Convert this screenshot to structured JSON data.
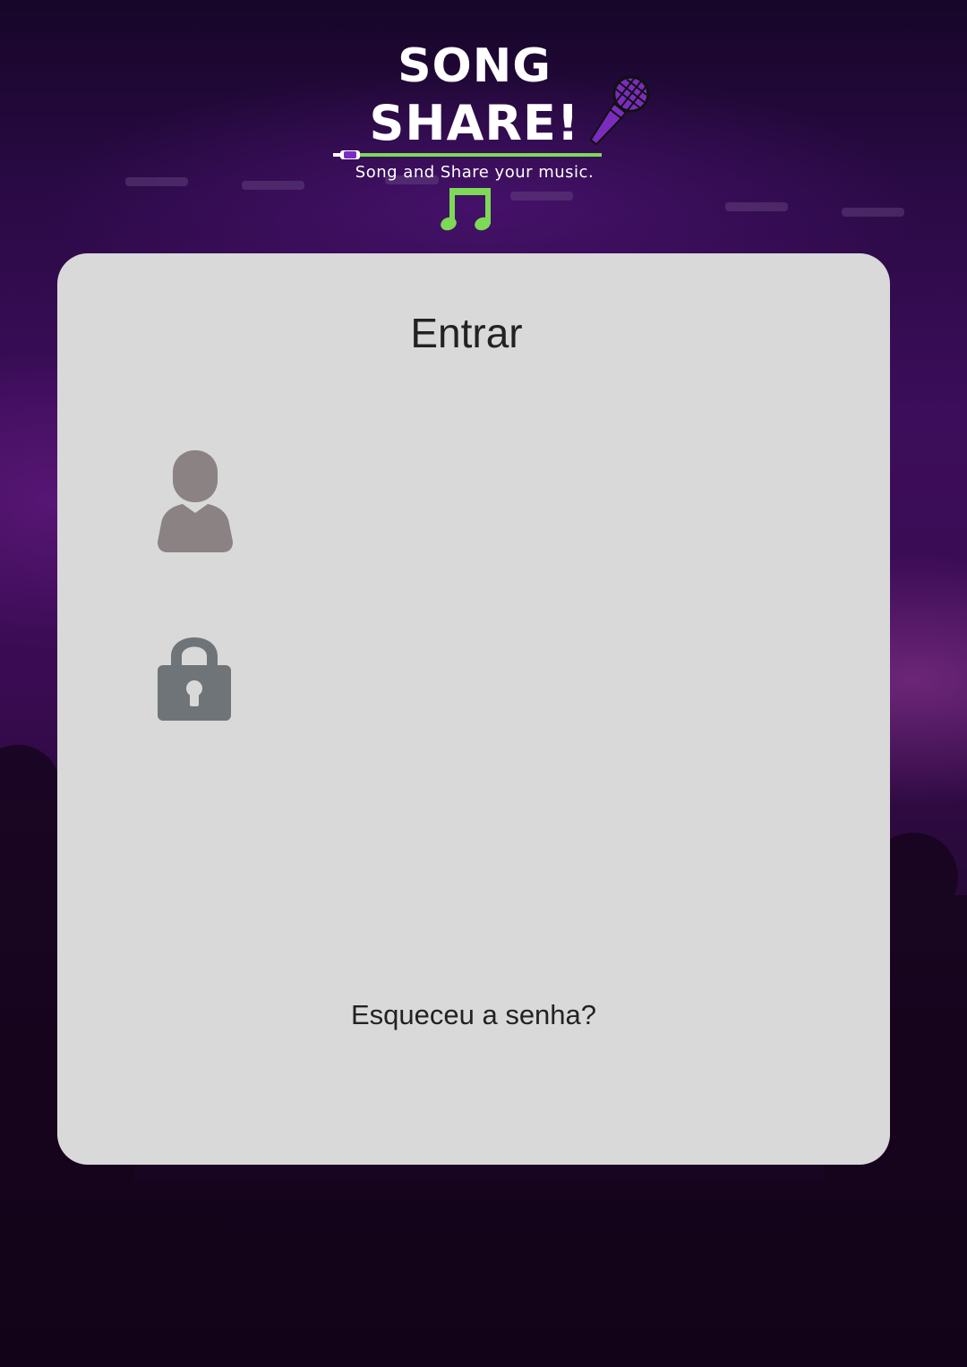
{
  "logo": {
    "line1": "SONG",
    "line2": "SHARE!",
    "tagline": "Song and Share your music.",
    "icons": [
      "microphone-icon",
      "music-note-icon",
      "audio-cable-icon"
    ],
    "accent_green": "#7ed957",
    "accent_purple": "#7b2cbf"
  },
  "login": {
    "title": "Entrar",
    "username": {
      "icon": "user-icon",
      "value": "",
      "placeholder": ""
    },
    "password": {
      "icon": "lock-icon",
      "value": "",
      "placeholder": ""
    },
    "forgot_password": "Esqueceu a senha?"
  },
  "colors": {
    "card_background": "#d9d9d9",
    "page_background": "#2a0a45",
    "icon_gray": "#8a8283",
    "lock_gray": "#6f7478"
  }
}
